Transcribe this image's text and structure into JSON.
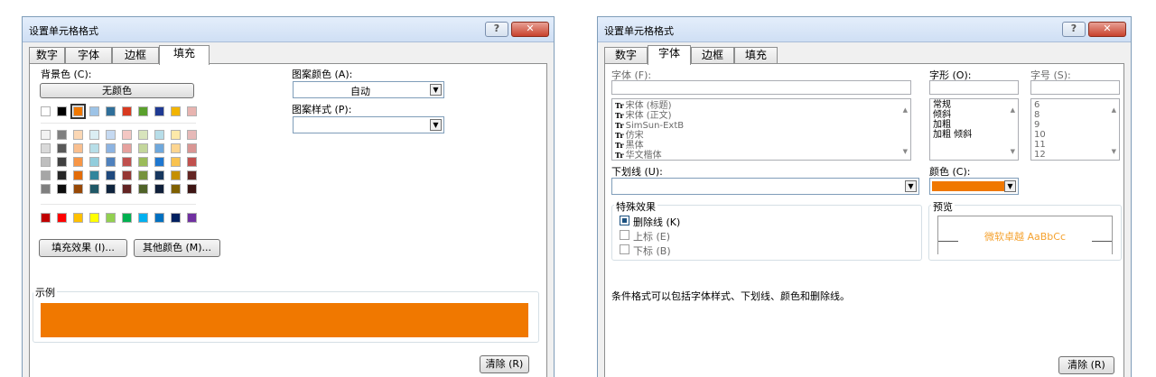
{
  "left_dialog": {
    "title": "设置单元格格式",
    "help": "?",
    "close": "✕",
    "tabs": [
      "数字",
      "字体",
      "边框",
      "填充"
    ],
    "active_tab": "填充",
    "background_color_label": "背景色 (C):",
    "no_color": "无颜色",
    "pattern_color_label": "图案颜色 (A):",
    "pattern_color_value": "自动",
    "pattern_style_label": "图案样式 (P):",
    "pattern_style_value": "",
    "fill_effects": "填充效果 (I)...",
    "more_colors": "其他颜色 (M)...",
    "sample_label": "示例",
    "sample_color": "#f07800",
    "clear": "清除 (R)",
    "palette_row1": [
      "#ffffff",
      "#000000",
      "#f07800",
      "#9dc3e6",
      "#2f6f9a",
      "#d83a20",
      "#5aa02c",
      "#1f3a93",
      "#f2b400",
      "#e8b4b0"
    ],
    "palette_rows": [
      [
        "#f2f2f2",
        "#7f7f7f",
        "#fbd7b4",
        "#dbeef3",
        "#c5d9f1",
        "#f4c7c3",
        "#d8e4bc",
        "#b7dde8",
        "#fde9a9",
        "#e6b9b8"
      ],
      [
        "#d9d9d9",
        "#595959",
        "#f9bf8f",
        "#b7dee8",
        "#8db4e2",
        "#e6a19e",
        "#c3d69b",
        "#6fa8dc",
        "#fcd590",
        "#d99694"
      ],
      [
        "#bfbfbf",
        "#404040",
        "#f79646",
        "#92cddc",
        "#4f81bd",
        "#c0504d",
        "#9bbb59",
        "#1f77d0",
        "#f9c24f",
        "#c0504d"
      ],
      [
        "#a6a6a6",
        "#262626",
        "#e36c09",
        "#31859c",
        "#1f497d",
        "#953734",
        "#76923c",
        "#17375e",
        "#c58f00",
        "#632523"
      ],
      [
        "#7f7f7f",
        "#0d0d0d",
        "#974806",
        "#205867",
        "#0f243e",
        "#632423",
        "#4f6228",
        "#0f1f3a",
        "#7f6000",
        "#3d1513"
      ]
    ],
    "palette_standard": [
      "#c00000",
      "#ff0000",
      "#ffc000",
      "#ffff00",
      "#92d050",
      "#00b050",
      "#00b0f0",
      "#0070c0",
      "#002060",
      "#7030a0"
    ]
  },
  "right_dialog": {
    "title": "设置单元格格式",
    "help": "?",
    "close": "✕",
    "tabs": [
      "数字",
      "字体",
      "边框",
      "填充"
    ],
    "active_tab": "字体",
    "font_label": "字体 (F):",
    "font_value": "",
    "font_list": [
      "宋体 (标题)",
      "宋体 (正文)",
      "SimSun-ExtB",
      "仿宋",
      "黑体",
      "华文楷体"
    ],
    "font_style_label": "字形 (O):",
    "font_style_list": [
      "常规",
      "倾斜",
      "加粗",
      "加粗 倾斜"
    ],
    "size_label": "字号 (S):",
    "size_list": [
      "6",
      "8",
      "9",
      "10",
      "11",
      "12"
    ],
    "underline_label": "下划线 (U):",
    "underline_value": "",
    "color_label": "颜色 (C):",
    "color_value": "#f07800",
    "effects_label": "特殊效果",
    "strikethrough": "删除线 (K)",
    "superscript": "上标 (E)",
    "subscript": "下标 (B)",
    "preview_label": "预览",
    "preview_text": "微软卓越 AaBbCc",
    "preview_color": "#f5a22f",
    "info_text": "条件格式可以包括字体样式、下划线、颜色和删除线。",
    "clear": "清除 (R)"
  }
}
